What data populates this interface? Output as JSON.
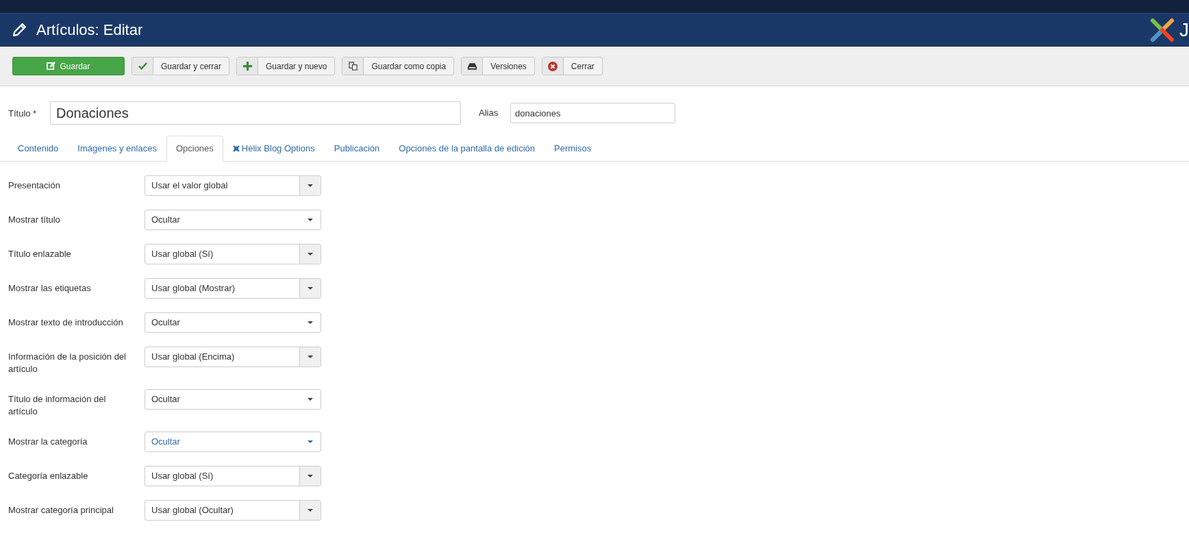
{
  "header": {
    "title": "Artículos: Editar",
    "logo_text": "J"
  },
  "toolbar": [
    {
      "label": "Guardar",
      "kind": "primary"
    },
    {
      "label": "Guardar y cerrar",
      "kind": "default"
    },
    {
      "label": "Guardar y nuevo",
      "kind": "default"
    },
    {
      "label": "Guardar como copia",
      "kind": "default"
    },
    {
      "label": "Versiones",
      "kind": "default"
    },
    {
      "label": "Cerrar",
      "kind": "default"
    }
  ],
  "title_field": {
    "label": "Título *",
    "value": "Donaciones"
  },
  "alias_field": {
    "label": "Alias",
    "value": "donaciones"
  },
  "tabs": [
    {
      "label": "Contenido",
      "selected": false,
      "kind": "plain"
    },
    {
      "label": "Imágenes y enlaces",
      "selected": false,
      "kind": "plain"
    },
    {
      "label": "Opciones",
      "selected": true,
      "kind": "plain"
    },
    {
      "label": "Helix Blog Options",
      "selected": false,
      "kind": "helix"
    },
    {
      "label": "Publicación",
      "selected": false,
      "kind": "plain"
    },
    {
      "label": "Opciones de la pantalla de edición",
      "selected": false,
      "kind": "plain"
    },
    {
      "label": "Permisos",
      "selected": false,
      "kind": "plain"
    }
  ],
  "options": [
    {
      "label": "Presentación",
      "value": "Usar el valor global",
      "kind": "split",
      "highlighted": false
    },
    {
      "label": "Mostrar título",
      "value": "Ocultar",
      "kind": "plain",
      "highlighted": false
    },
    {
      "label": "Título enlazable",
      "value": "Usar global (Sí)",
      "kind": "split",
      "highlighted": false
    },
    {
      "label": "Mostrar las etiquetas",
      "value": "Usar global (Mostrar)",
      "kind": "split",
      "highlighted": false
    },
    {
      "label": "Mostrar texto de introducción",
      "value": "Ocultar",
      "kind": "plain",
      "highlighted": false
    },
    {
      "label": "Información de la posición del artículo",
      "value": "Usar global (Encima)",
      "kind": "split",
      "highlighted": false
    },
    {
      "label": "Título de información del artículo",
      "value": "Ocultar",
      "kind": "plain",
      "highlighted": false
    },
    {
      "label": "Mostrar la categoría",
      "value": "Ocultar",
      "kind": "plain",
      "highlighted": true
    },
    {
      "label": "Categoría enlazable",
      "value": "Usar global (Sí)",
      "kind": "split",
      "highlighted": false
    },
    {
      "label": "Mostrar categoría principal",
      "value": "Usar global (Ocultar)",
      "kind": "split",
      "highlighted": false
    }
  ]
}
